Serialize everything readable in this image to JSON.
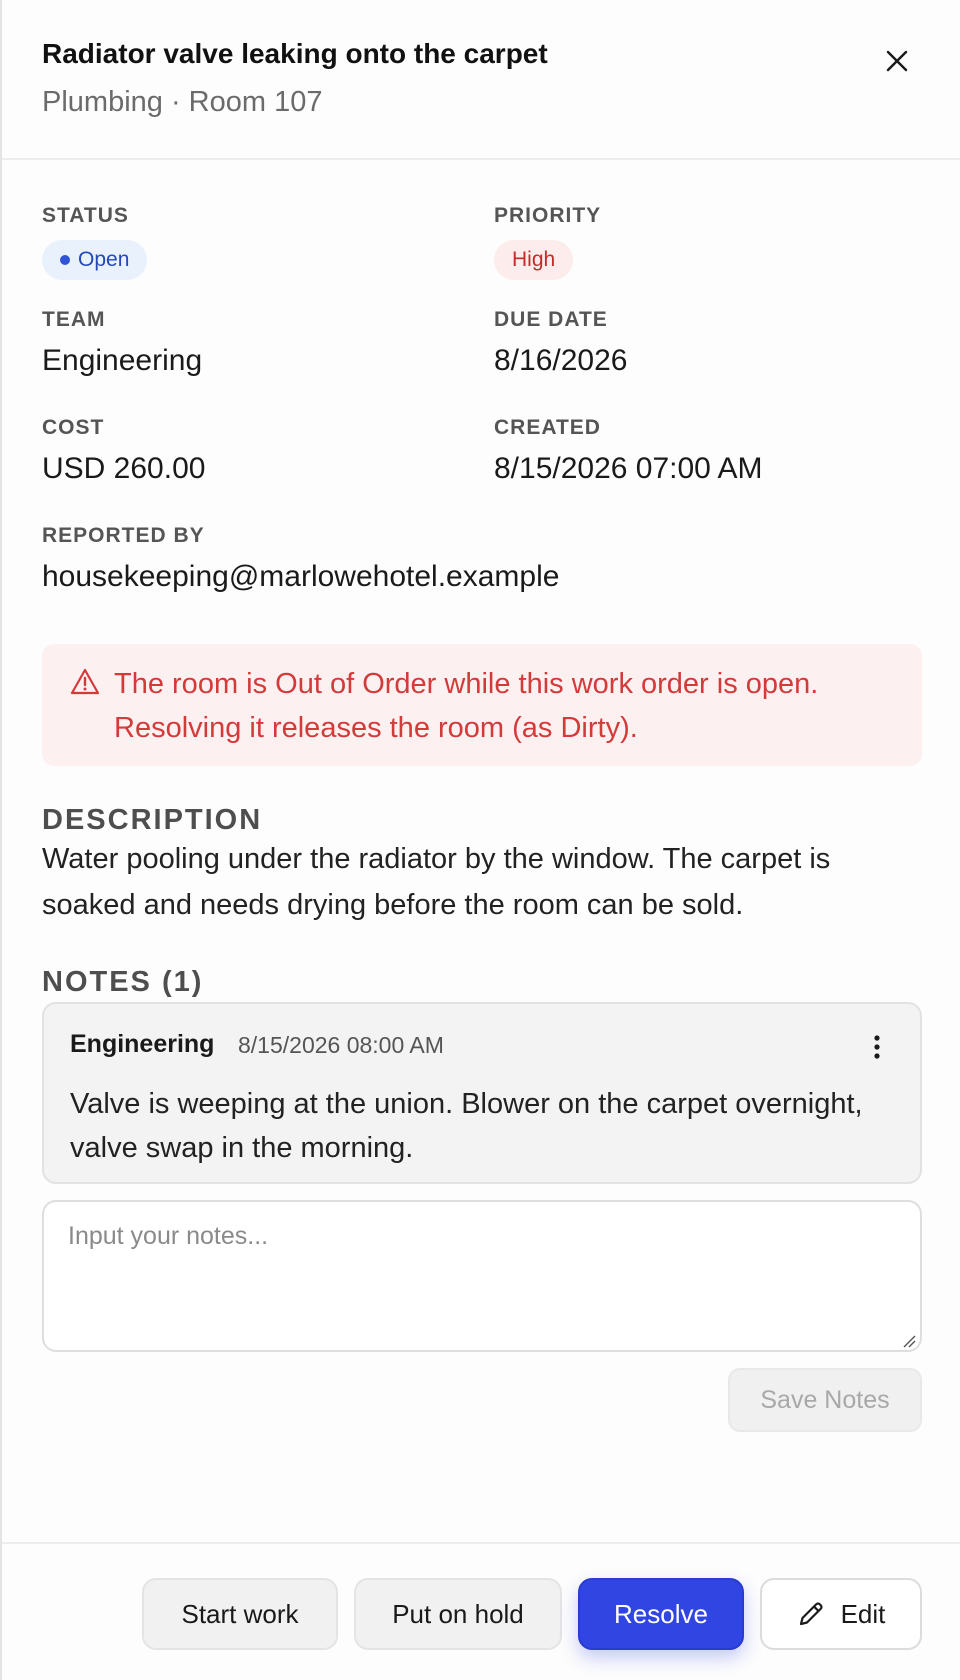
{
  "header": {
    "title": "Radiator valve leaking onto the carpet",
    "subtitle": "Plumbing · Room 107",
    "close_icon": "close-icon"
  },
  "fields": {
    "status": {
      "label": "STATUS",
      "value": "Open",
      "color": "#2f55d4"
    },
    "priority": {
      "label": "PRIORITY",
      "value": "High",
      "color": "#c62a2a"
    },
    "team": {
      "label": "TEAM",
      "value": "Engineering"
    },
    "due_date": {
      "label": "DUE DATE",
      "value": "8/16/2026"
    },
    "cost": {
      "label": "COST",
      "value": "USD 260.00"
    },
    "created": {
      "label": "CREATED",
      "value": "8/15/2026 07:00 AM"
    },
    "reported_by": {
      "label": "REPORTED BY",
      "value": "housekeeping@marlowehotel.example"
    }
  },
  "alert": {
    "icon": "warning-icon",
    "text": "The room is Out of Order while this work order is open. Resolving it releases the room (as Dirty)."
  },
  "description": {
    "title": "DESCRIPTION",
    "text": "Water pooling under the radiator by the window. The carpet is soaked and needs drying before the room can be sold."
  },
  "notes": {
    "title": "NOTES (1)",
    "items": [
      {
        "author": "Engineering",
        "time": "8/15/2026 08:00 AM",
        "text": "Valve is weeping at the union. Blower on the carpet overnight, valve swap in the morning."
      }
    ],
    "input_placeholder": "Input your notes...",
    "input_value": "",
    "save_label": "Save Notes"
  },
  "footer": {
    "start_work": "Start work",
    "put_on_hold": "Put on hold",
    "resolve": "Resolve",
    "edit": "Edit",
    "edit_icon": "pencil-icon"
  },
  "colors": {
    "primary": "#3145e3",
    "danger": "#d33a3a",
    "danger_bg": "#fdf0f0"
  }
}
